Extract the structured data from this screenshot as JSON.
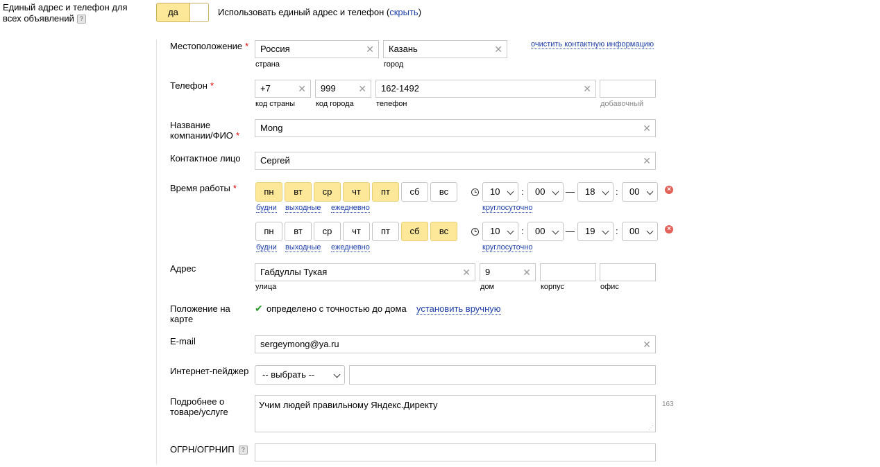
{
  "top": {
    "label_line1": "Единый адрес и телефон для",
    "label_line2": "всех объявлений",
    "help": "?",
    "toggle_yes": "да",
    "desc": "Использовать единый адрес и телефон (",
    "hide_link": "скрыть",
    "desc_end": ")"
  },
  "location": {
    "label": "Местоположение",
    "required": "*",
    "country": "Россия",
    "country_sub": "страна",
    "city": "Казань",
    "city_sub": "город",
    "clear_link": "очистить контактную информацию"
  },
  "phone": {
    "label": "Телефон",
    "required": "*",
    "country_code": "+7",
    "country_code_sub": "код страны",
    "city_code": "999",
    "city_code_sub": "код города",
    "number": "162-1492",
    "number_sub": "телефон",
    "ext": "",
    "ext_sub": "добавочный"
  },
  "company": {
    "label_line1": "Название",
    "label_line2": "компании/ФИО",
    "required": "*",
    "value": "Mong"
  },
  "contact": {
    "label": "Контактное лицо",
    "value": "Сергей"
  },
  "hours": {
    "label": "Время работы",
    "required": "*",
    "rows": [
      {
        "days": [
          {
            "label": "пн",
            "on": true
          },
          {
            "label": "вт",
            "on": true
          },
          {
            "label": "ср",
            "on": true
          },
          {
            "label": "чт",
            "on": true
          },
          {
            "label": "пт",
            "on": true
          },
          {
            "label": "сб",
            "on": false
          },
          {
            "label": "вс",
            "on": false
          }
        ],
        "from_h": "10",
        "from_m": "00",
        "to_h": "18",
        "to_m": "00"
      },
      {
        "days": [
          {
            "label": "пн",
            "on": false
          },
          {
            "label": "вт",
            "on": false
          },
          {
            "label": "ср",
            "on": false
          },
          {
            "label": "чт",
            "on": false
          },
          {
            "label": "пт",
            "on": false
          },
          {
            "label": "сб",
            "on": true
          },
          {
            "label": "вс",
            "on": true
          }
        ],
        "from_h": "10",
        "from_m": "00",
        "to_h": "19",
        "to_m": "00"
      }
    ],
    "preset_weekdays": "будни",
    "preset_weekend": "выходные",
    "preset_daily": "ежедневно",
    "round_clock": "круглосуточно",
    "colon": ":",
    "dash": "—",
    "delete": "×"
  },
  "address": {
    "label": "Адрес",
    "street": "Габдуллы Тукая",
    "street_sub": "улица",
    "house": "9",
    "house_sub": "дом",
    "building": "",
    "building_sub": "корпус",
    "office": "",
    "office_sub": "офис"
  },
  "map": {
    "label_line1": "Положение на",
    "label_line2": "карте",
    "check": "✔",
    "status": "определено с точностью до дома",
    "manual_link": "установить вручную"
  },
  "email": {
    "label": "E-mail",
    "value": "sergeymong@ya.ru"
  },
  "pager": {
    "label": "Интернет-пейджер",
    "select": "-- выбрать --",
    "value": ""
  },
  "details": {
    "label_line1": "Подробнее о",
    "label_line2": "товаре/услуге",
    "value": "Учим людей правильному Яндекс.Директу",
    "counter": "163"
  },
  "ogrn": {
    "label": "ОГРН/ОГРНИП",
    "help": "?",
    "value": ""
  },
  "colors": {
    "accent": "#fde89a",
    "link": "#1e3fa8",
    "required": "#dd0000",
    "delete": "#e2625a",
    "check": "#2a9d2a"
  }
}
